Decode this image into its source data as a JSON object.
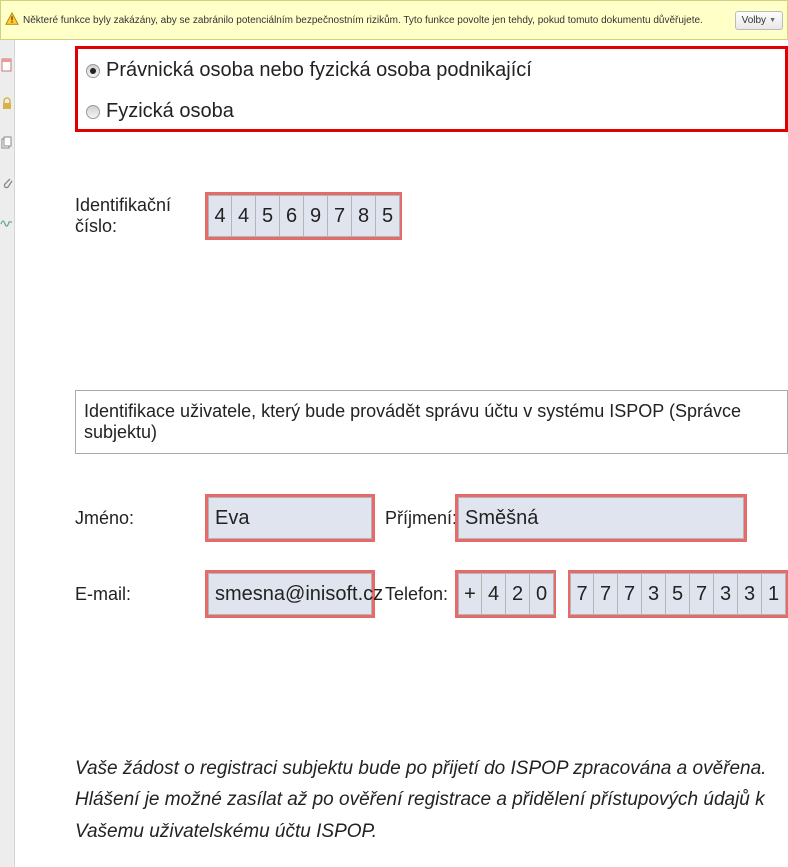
{
  "warning": {
    "text": "Některé funkce byly zakázány, aby se zabránilo potenciálním bezpečnostním rizikům. Tyto funkce povolte jen tehdy, pokud tomuto dokumentu důvěřujete.",
    "button": "Volby"
  },
  "type_box": {
    "option1": "Právnická osoba nebo fyzická osoba podnikající",
    "option2": "Fyzická osoba"
  },
  "ico": {
    "label": "Identifikační číslo:",
    "digits": [
      "4",
      "4",
      "5",
      "6",
      "9",
      "7",
      "8",
      "5"
    ]
  },
  "section_header": "Identifikace uživatele, který bude provádět správu účtu v systému ISPOP (Správce subjektu)",
  "name": {
    "first_label": "Jméno:",
    "first_value": "Eva",
    "last_label": "Příjmení:",
    "last_value": "Směšná"
  },
  "email": {
    "label": "E-mail:",
    "value": "smesna@inisoft.cz"
  },
  "phone": {
    "label": "Telefon:",
    "prefix": [
      "+",
      "4",
      "2",
      "0"
    ],
    "digits": [
      "7",
      "7",
      "7",
      "3",
      "5",
      "7",
      "3",
      "3",
      "1"
    ]
  },
  "note": "Vaše žádost o registraci subjektu bude po přijetí do ISPOP zpracována a ověřena. Hlášení je možné zasílat až po ověření registrace a přidělení přístupových údajů k Vašemu uživatelskému účtu ISPOP."
}
